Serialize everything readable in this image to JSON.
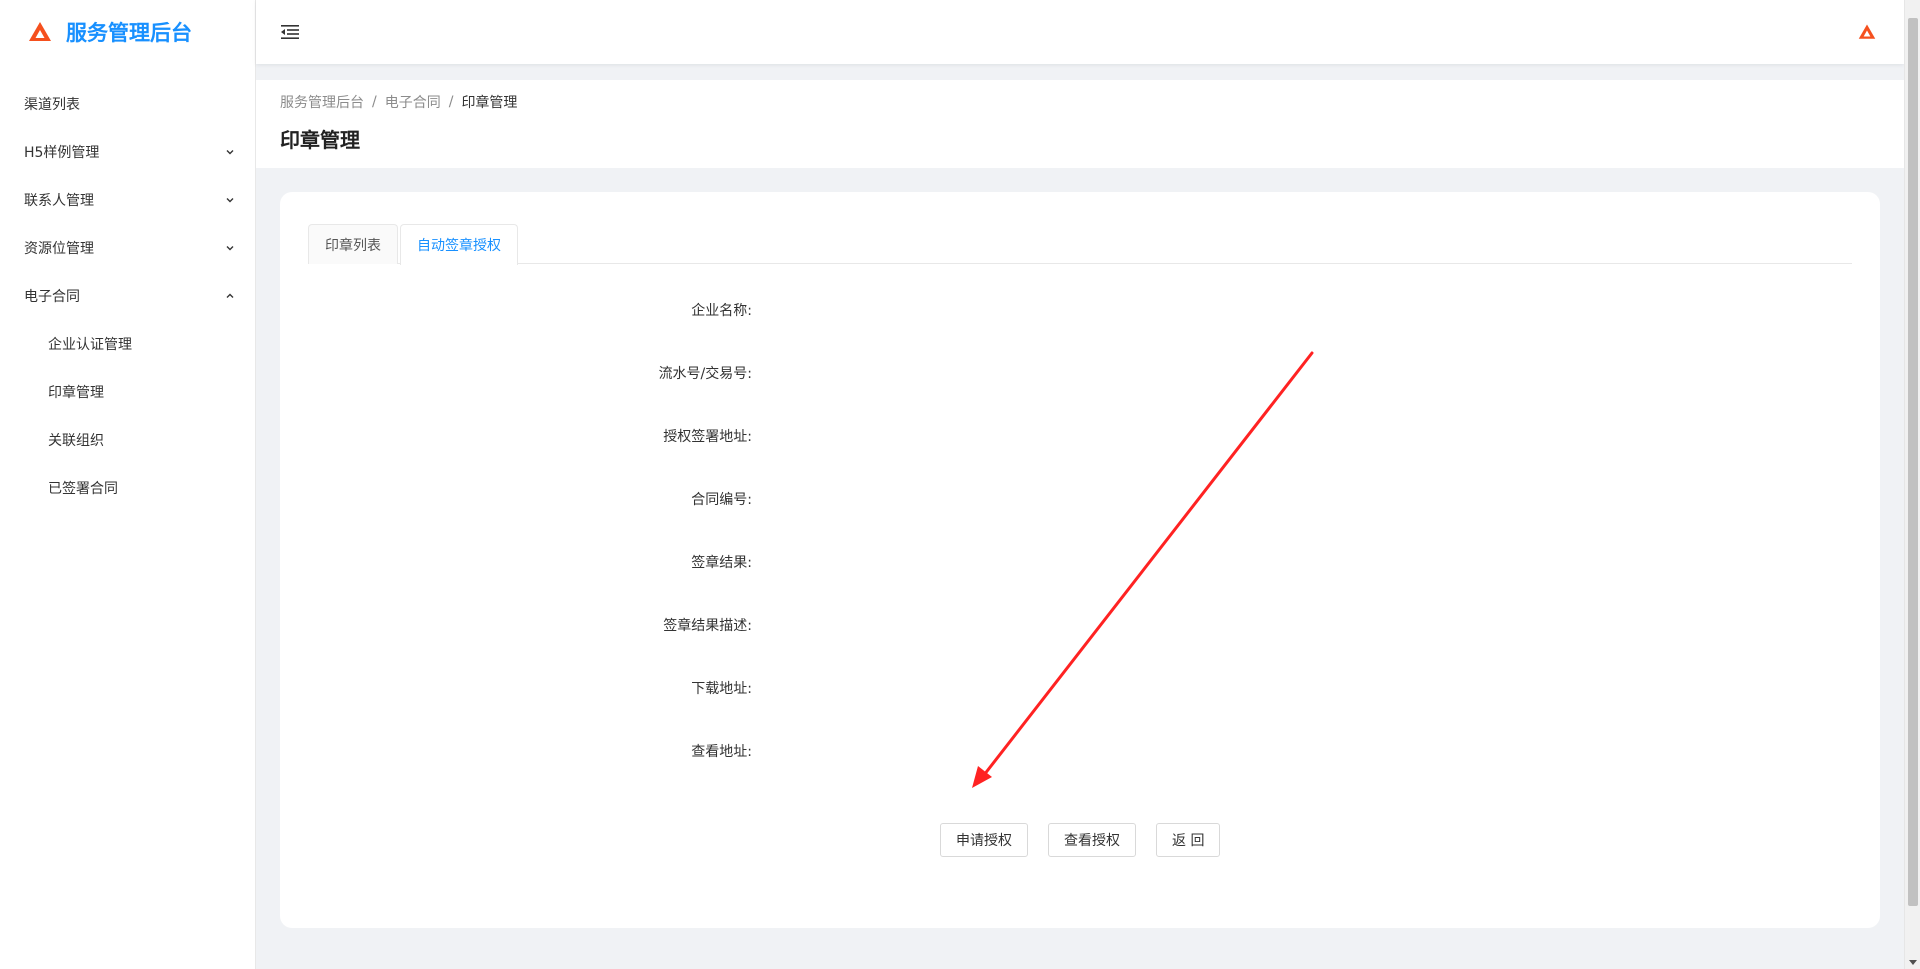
{
  "app": {
    "title": "服务管理后台"
  },
  "sidebar": {
    "items": [
      {
        "label": "渠道列表",
        "has_arrow": false,
        "level": 1
      },
      {
        "label": "H5样例管理",
        "has_arrow": true,
        "expanded": false,
        "level": 1
      },
      {
        "label": "联系人管理",
        "has_arrow": true,
        "expanded": false,
        "level": 1
      },
      {
        "label": "资源位管理",
        "has_arrow": true,
        "expanded": false,
        "level": 1
      },
      {
        "label": "电子合同",
        "has_arrow": true,
        "expanded": true,
        "level": 1
      },
      {
        "label": "企业认证管理",
        "level": 2
      },
      {
        "label": "印章管理",
        "level": 2
      },
      {
        "label": "关联组织",
        "level": 2
      },
      {
        "label": "已签署合同",
        "level": 2
      }
    ]
  },
  "breadcrumb": [
    "服务管理后台",
    "电子合同",
    "印章管理"
  ],
  "page": {
    "title": "印章管理"
  },
  "tabs": [
    {
      "label": "印章列表",
      "active": false
    },
    {
      "label": "自动签章授权",
      "active": true
    }
  ],
  "form": {
    "fields": [
      {
        "label": "企业名称:",
        "value": ""
      },
      {
        "label": "流水号/交易号:",
        "value": ""
      },
      {
        "label": "授权签署地址:",
        "value": ""
      },
      {
        "label": "合同编号:",
        "value": ""
      },
      {
        "label": "签章结果:",
        "value": ""
      },
      {
        "label": "签章结果描述:",
        "value": ""
      },
      {
        "label": "下载地址:",
        "value": ""
      },
      {
        "label": "查看地址:",
        "value": ""
      }
    ]
  },
  "actions": {
    "apply_label": "申请授权",
    "view_label": "查看授权",
    "back_label": "返 回"
  },
  "colors": {
    "accent": "#1890ff",
    "logo": "#f5501e",
    "annotation": "#ff2222"
  },
  "icons": {
    "logo": "triangle-logo-icon",
    "menu_toggle": "menu-fold-icon",
    "chevron_down": "chevron-down-icon",
    "chevron_up": "chevron-up-icon"
  }
}
